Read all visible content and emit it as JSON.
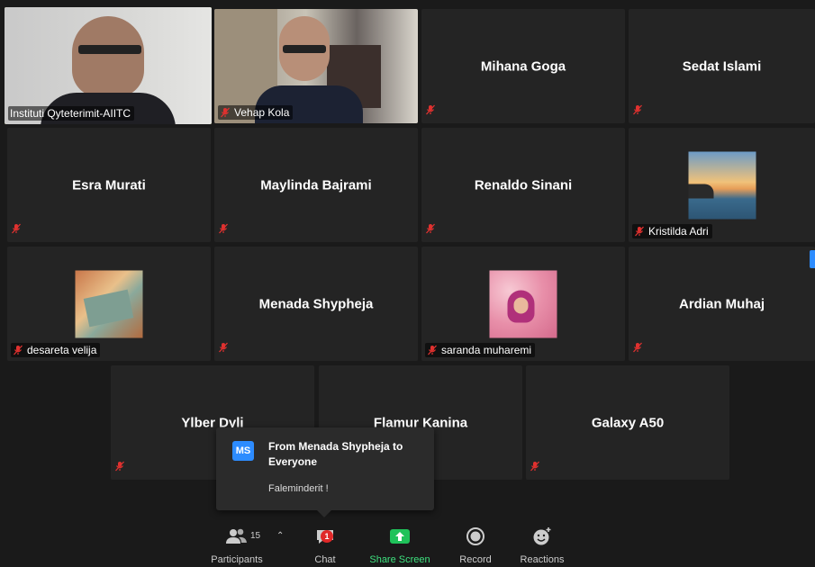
{
  "participants": {
    "p1": {
      "name": "Instituti Qyteterimit-AIITC"
    },
    "p2": {
      "name": "Vehap Kola"
    },
    "p3": {
      "name": "Mihana Goga"
    },
    "p4": {
      "name": "Sedat Islami"
    },
    "p5": {
      "name": "Esra Murati"
    },
    "p6": {
      "name": "Maylinda Bajrami"
    },
    "p7": {
      "name": "Renaldo Sinani"
    },
    "p8": {
      "name": "Kristilda Adri"
    },
    "p9": {
      "name": "desareta velija"
    },
    "p10": {
      "name": "Menada Shypheja"
    },
    "p11": {
      "name": "saranda muharemi"
    },
    "p12": {
      "name": "Ardian Muhaj"
    },
    "p13": {
      "name": "Ylber Dyli"
    },
    "p14": {
      "name": "Flamur Kanina"
    },
    "p15": {
      "name": "Galaxy A50"
    }
  },
  "chat_popup": {
    "initials": "MS",
    "title": "From Menada Shypheja to Everyone",
    "message": "Faleminderit !"
  },
  "toolbar": {
    "participants_label": "Participants",
    "participants_count": "15",
    "chat_label": "Chat",
    "chat_badge": "1",
    "share_label": "Share Screen",
    "record_label": "Record",
    "reactions_label": "Reactions"
  },
  "colors": {
    "active_speaker": "#e4f26b",
    "share_green": "#3ee07e",
    "mute_red": "#e0312f",
    "badge_red": "#e02828",
    "avatar_blue": "#2d8cff"
  },
  "icons": {
    "mute": "mic-muted-icon",
    "participants": "participants-icon",
    "chat": "chat-icon",
    "share": "share-screen-icon",
    "record": "record-icon",
    "reactions": "reactions-icon"
  }
}
